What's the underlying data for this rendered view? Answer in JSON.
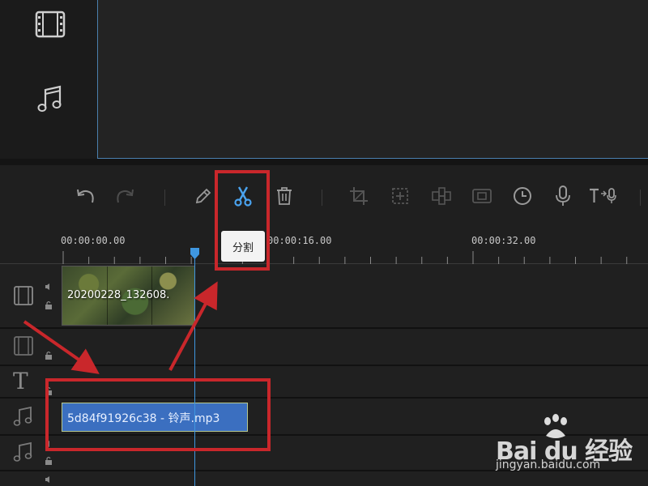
{
  "sidebar": {
    "items": [
      {
        "icon": "film-icon"
      },
      {
        "icon": "music-note-icon"
      }
    ]
  },
  "toolbar": {
    "buttons": [
      "undo-icon",
      "redo-icon",
      "pencil-icon",
      "scissors-icon",
      "trash-icon",
      "crop-icon",
      "zoom-icon",
      "mosaic-icon",
      "freeze-frame-icon",
      "clock-icon",
      "microphone-icon",
      "text-to-speech-icon"
    ],
    "split_tooltip": "分割"
  },
  "ruler": {
    "labels": [
      "00:00:00.00",
      "00:00:16.00",
      "00:00:32.00"
    ]
  },
  "timeline": {
    "video_clip_label": "20200228_132608.",
    "audio_clip_label": "5d84f91926c38 - 铃声.mp3",
    "text_track_icon": "T"
  },
  "watermark": {
    "brand": "Bai du 经验",
    "domain": "jingyan.baidu.com"
  },
  "colors": {
    "accent": "#3f97e0",
    "annotation_red": "#c9272b",
    "audio_clip": "#3b6fc0"
  }
}
